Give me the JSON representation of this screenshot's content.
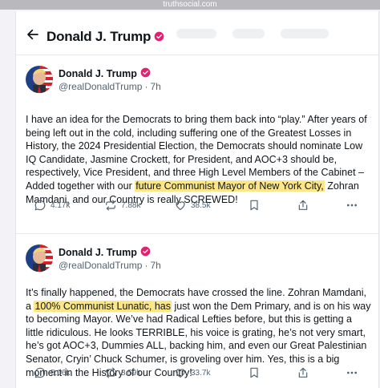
{
  "browser": {
    "url": "truthsocial.com"
  },
  "header": {
    "title": "Donald J. Trump"
  },
  "posts": [
    {
      "name": "Donald J. Trump",
      "handle": "@realDonaldTrump",
      "time": "7h",
      "text_before": "I have an idea for the Democrats to bring them back into “play.” After years of being left out in the cold, including suffering one of the Greatest Losses in History, the 2024 Presidential Election, the Democrats should nominate Low IQ Candidate, Jasmine Crockett, for President, and AOC+3 should be, respectively, Vice President, and three High Level Members of the Cabinet – Added together with our ",
      "text_highlight": "future Communist Mayor of New York City,",
      "text_after": " Zohran Mamdani, and our Country is really SCREWED!",
      "replies": "4.17k",
      "retruths": "7.88k",
      "likes": "38.5k"
    },
    {
      "name": "Donald J. Trump",
      "handle": "@realDonaldTrump",
      "time": "7h",
      "text_before": "It’s finally happened, the Democrats have crossed the line. Zohran Mamdani, a ",
      "text_highlight": "100% Communist Lunatic, has",
      "text_after": " just won the Dem Primary, and is on his way to becoming Mayor. We’ve had Radical Lefties before, but this is getting a little ridiculous. He looks TERRIBLE, his voice is grating, he’s not very smart, he’s got AOC+3, Dummies ALL, backing him, and even our Great Palestinian Senator, Cryin’ Chuck Schumer, is groveling over him. Yes, this is a big moment in the History of our Country!",
      "replies": "5.06k",
      "retruths": "8.59k",
      "likes": "33.7k"
    }
  ],
  "icons": {
    "back": "arrow-left-icon",
    "verified": "verified-badge-icon",
    "reply": "reply-icon",
    "retruth": "retruth-icon",
    "like": "heart-icon",
    "bookmark": "bookmark-icon",
    "share": "share-icon",
    "more": "more-icon"
  },
  "colors": {
    "verified": "#e2226e",
    "highlight": "#fbe78a",
    "muted": "#536471"
  }
}
